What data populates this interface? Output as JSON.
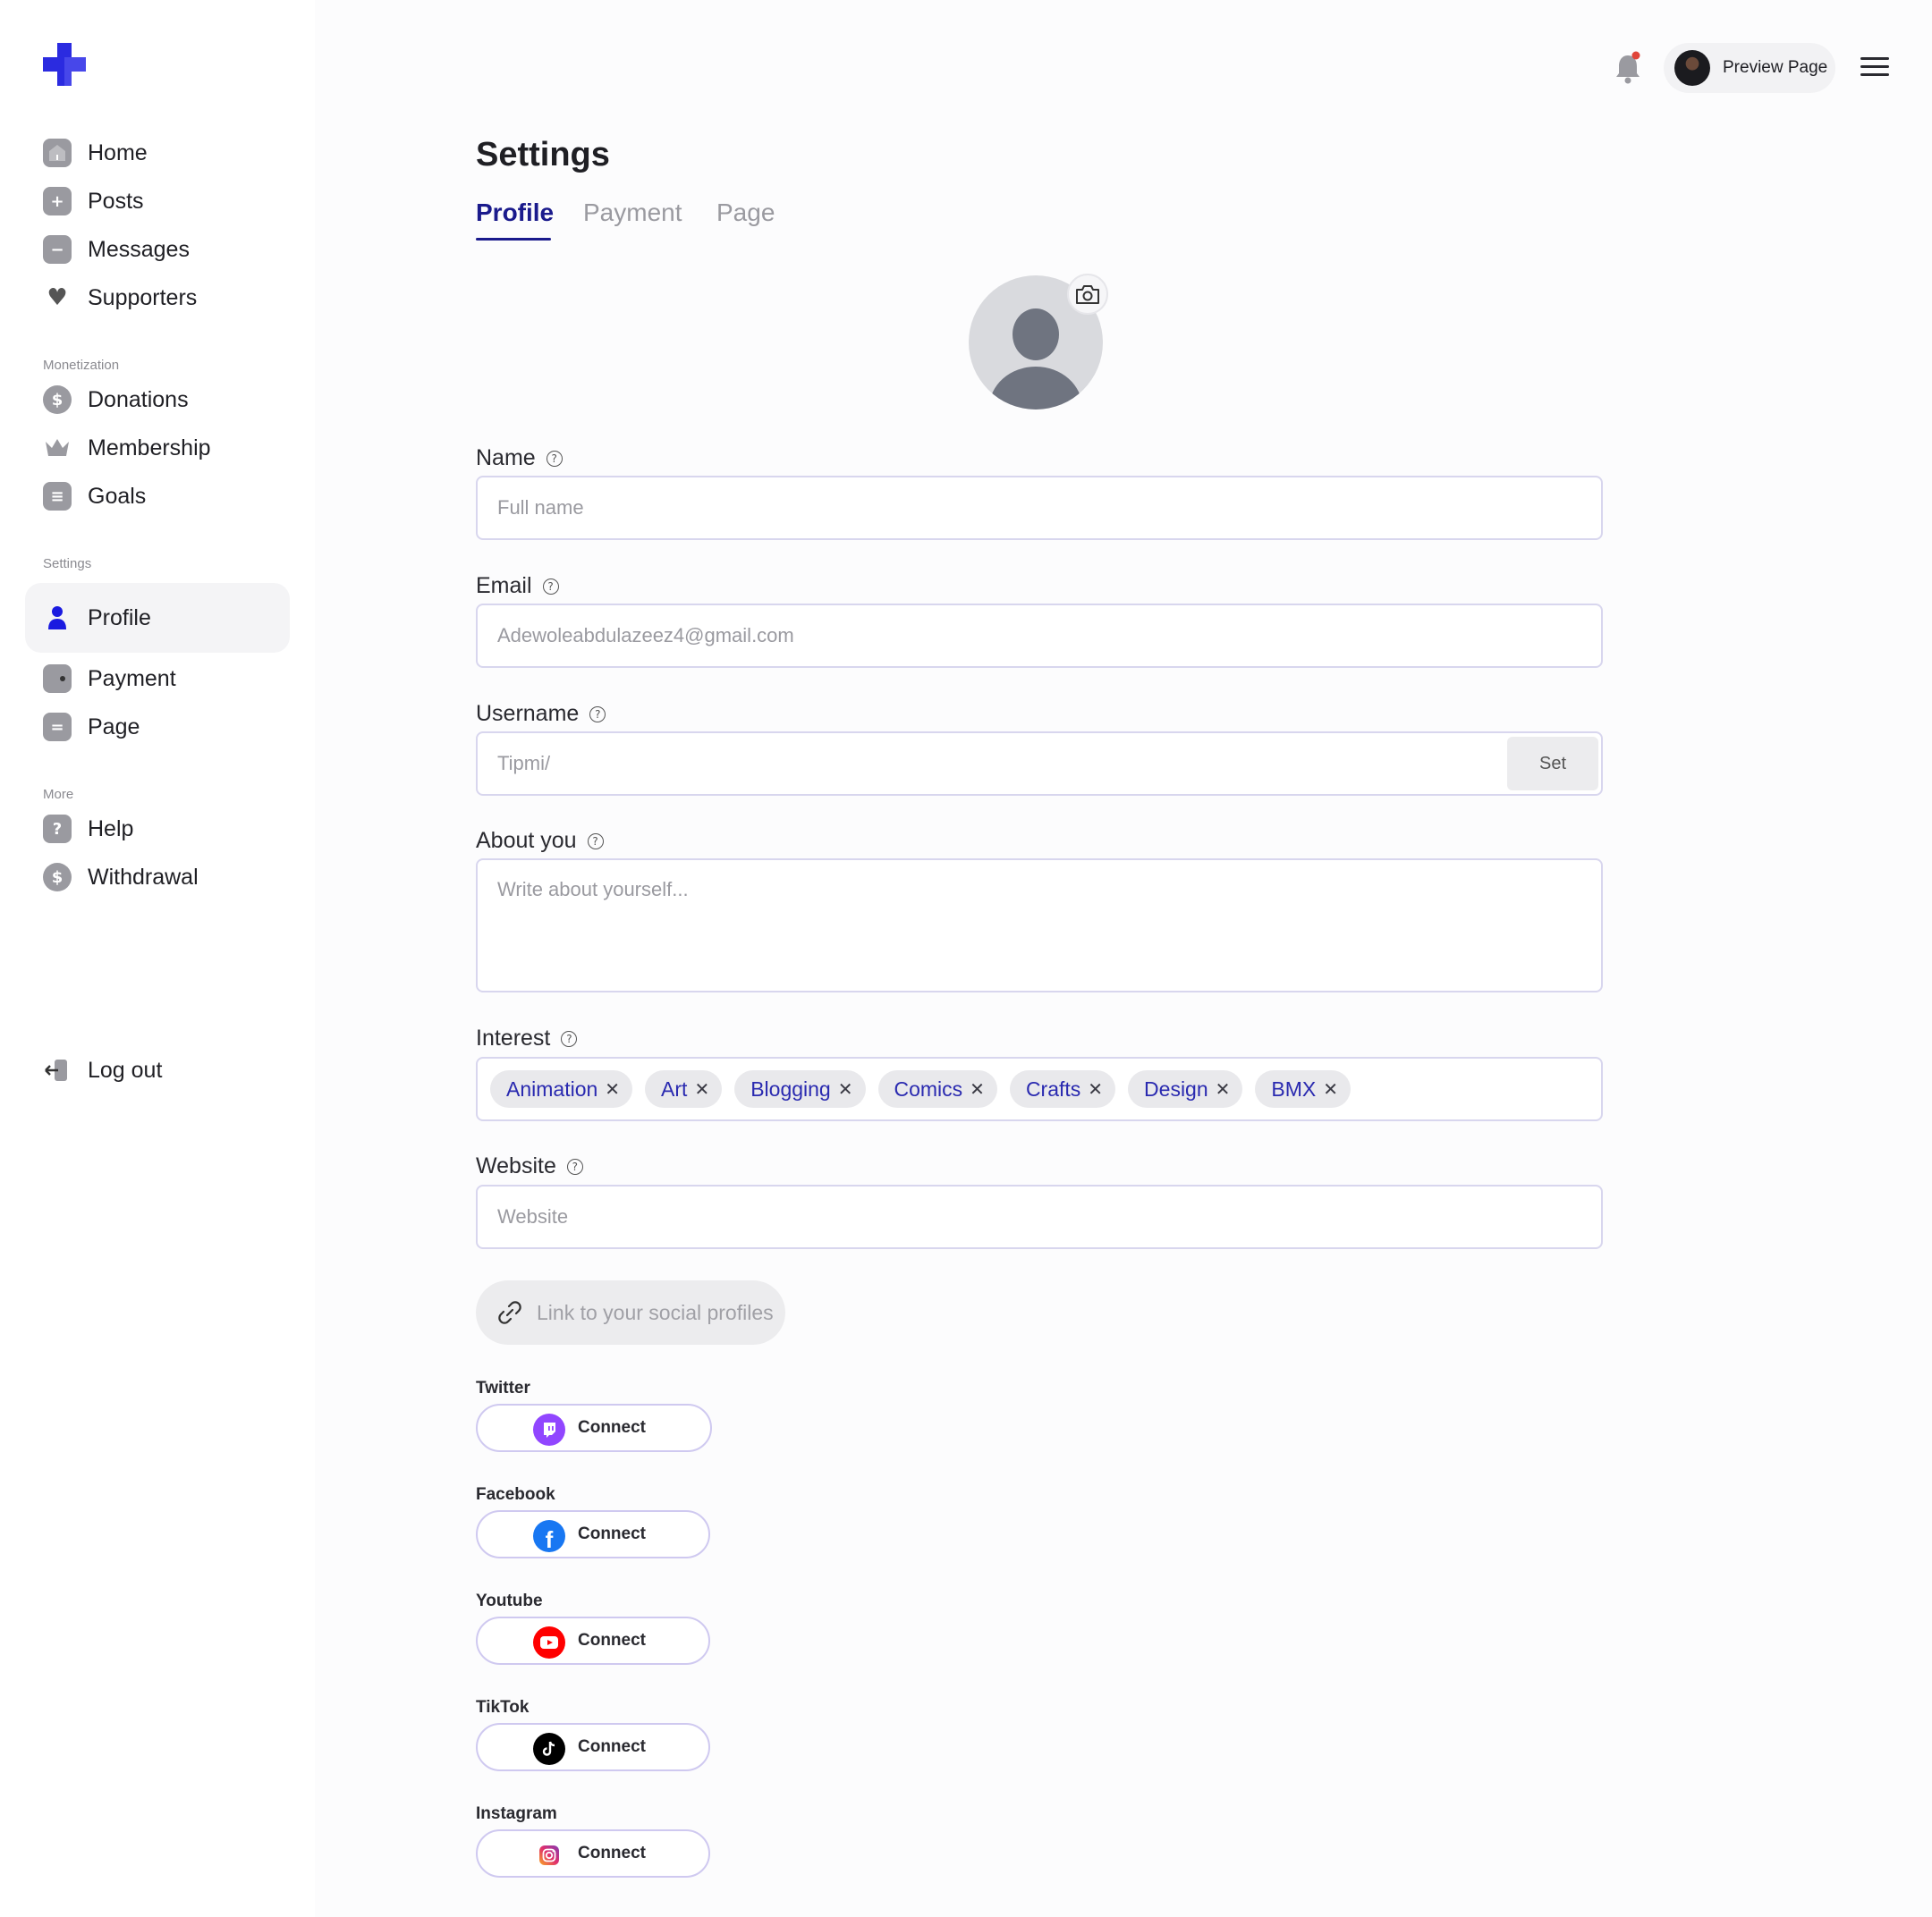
{
  "sidebar": {
    "items": [
      {
        "label": "Home"
      },
      {
        "label": "Posts"
      },
      {
        "label": "Messages"
      },
      {
        "label": "Supporters"
      }
    ],
    "monetization_title": "Monetization",
    "monetization": [
      {
        "label": "Donations"
      },
      {
        "label": "Membership"
      },
      {
        "label": "Goals"
      }
    ],
    "settings_title": "Settings",
    "settings": [
      {
        "label": "Profile"
      },
      {
        "label": "Payment"
      },
      {
        "label": "Page"
      }
    ],
    "more_title": "More",
    "more": [
      {
        "label": "Help"
      },
      {
        "label": "Withdrawal"
      }
    ],
    "logout_label": "Log out"
  },
  "topbar": {
    "preview_label": "Preview Page"
  },
  "page": {
    "title": "Settings",
    "tabs": [
      "Profile",
      "Payment",
      "Page"
    ],
    "active_tab": "Profile"
  },
  "form": {
    "name": {
      "label": "Name",
      "placeholder": "Full name"
    },
    "email": {
      "label": "Email",
      "value": "Adewoleabdulazeez4@gmail.com"
    },
    "username": {
      "label": "Username",
      "placeholder": "Tipmi/",
      "set_label": "Set"
    },
    "about": {
      "label": "About you",
      "placeholder": "Write about yourself..."
    },
    "interest": {
      "label": "Interest",
      "chips": [
        "Animation",
        "Art",
        "Blogging",
        "Comics",
        "Crafts",
        "Design",
        "BMX"
      ]
    },
    "website": {
      "label": "Website",
      "placeholder": "Website"
    },
    "social_link_label": "Link to your social profiles"
  },
  "socials": [
    {
      "name": "Twitter",
      "button": "Connect",
      "icon": "twitch-icon",
      "color": "#9146ff"
    },
    {
      "name": "Facebook",
      "button": "Connect",
      "icon": "facebook-icon",
      "color": "#1877f2"
    },
    {
      "name": "Youtube",
      "button": "Connect",
      "icon": "youtube-icon",
      "color": "#ff0000"
    },
    {
      "name": "TikTok",
      "button": "Connect",
      "icon": "tiktok-icon",
      "color": "#000000"
    },
    {
      "name": "Instagram",
      "button": "Connect",
      "icon": "instagram-icon",
      "color": "#e1306c"
    }
  ],
  "colors": {
    "accent": "#1a1a8c",
    "brand": "#2b2be0",
    "chip_text": "#2a2ab0",
    "notification_dot": "#e0453a"
  }
}
